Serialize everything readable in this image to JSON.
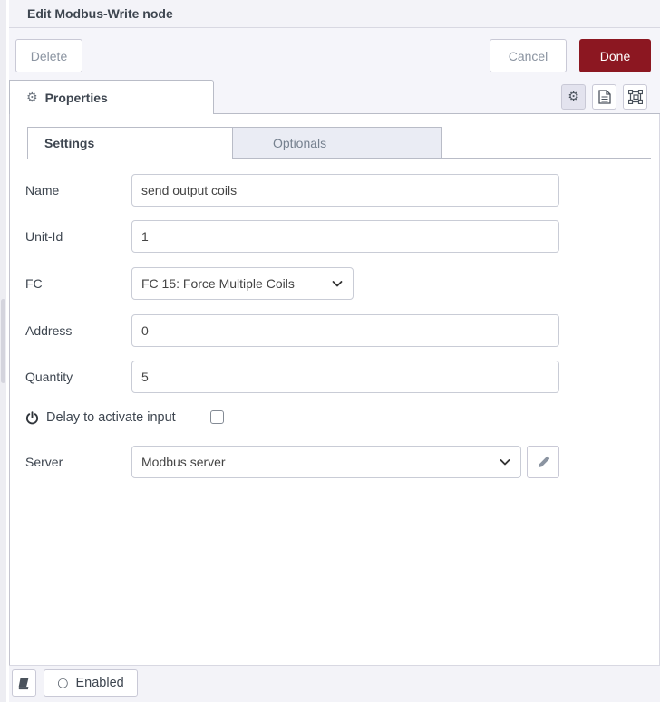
{
  "header": {
    "title": "Edit Modbus-Write node"
  },
  "toolbar": {
    "delete_label": "Delete",
    "cancel_label": "Cancel",
    "done_label": "Done"
  },
  "properties_tab": {
    "label": "Properties"
  },
  "icons": {
    "gear_glyph": "⚙",
    "circle_glyph": "○"
  },
  "tabs": {
    "settings": "Settings",
    "optionals": "Optionals"
  },
  "form": {
    "name": {
      "label": "Name",
      "value": "send output coils"
    },
    "unit_id": {
      "label": "Unit-Id",
      "value": "1"
    },
    "fc": {
      "label": "FC",
      "value": "FC 15: Force Multiple Coils"
    },
    "address": {
      "label": "Address",
      "value": "0"
    },
    "quantity": {
      "label": "Quantity",
      "value": "5"
    },
    "delay": {
      "label": "Delay to activate input",
      "checked": false
    },
    "server": {
      "label": "Server",
      "value": "Modbus server"
    }
  },
  "footer": {
    "enabled_label": "Enabled"
  },
  "colors": {
    "done_button_bg": "#8c1721",
    "chrome_bg": "#f5f5fa",
    "active_tab_bg": "#ffffff",
    "inactive_tab_bg": "#eaecf4",
    "border": "#b9bcc7"
  }
}
